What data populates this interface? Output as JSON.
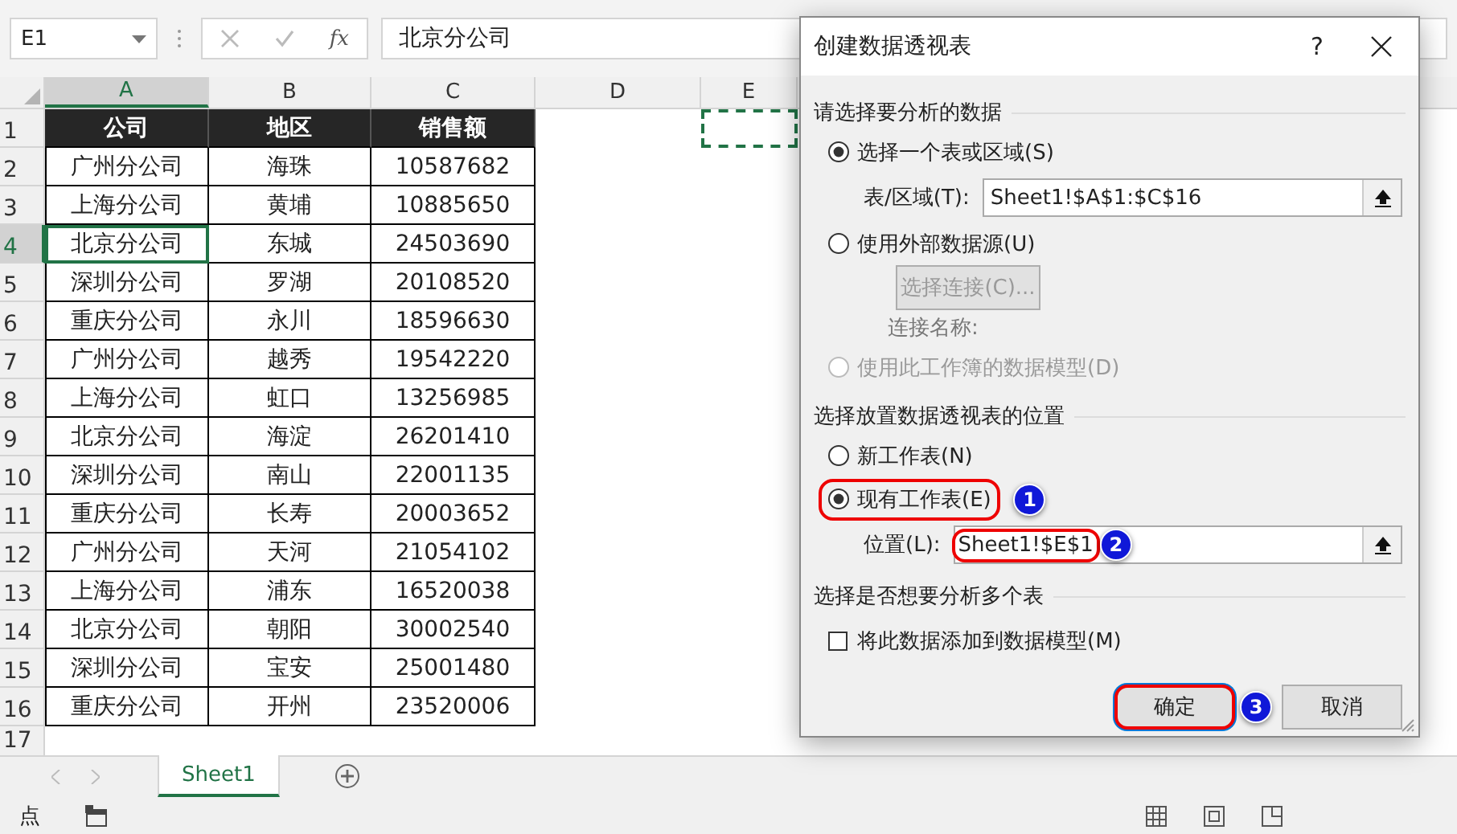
{
  "formula_bar": {
    "name_box": "E1",
    "function_label": "fx",
    "formula": "北京分公司"
  },
  "copy_marquee": true,
  "columns": [
    {
      "label": "A",
      "selected": true
    },
    {
      "label": "B",
      "selected": false
    },
    {
      "label": "C",
      "selected": false
    },
    {
      "label": "D",
      "selected": false
    },
    {
      "label": "E",
      "selected": false
    }
  ],
  "rows": [
    {
      "number": "1",
      "kind": "header",
      "selected": false,
      "cells": [
        "公司",
        "地区",
        "销售额"
      ]
    },
    {
      "number": "2",
      "kind": "data",
      "selected": false,
      "cells": [
        "广州分公司",
        "海珠",
        "10587682"
      ]
    },
    {
      "number": "3",
      "kind": "data",
      "selected": false,
      "cells": [
        "上海分公司",
        "黄埔",
        "10885650"
      ]
    },
    {
      "number": "4",
      "kind": "data",
      "selected": true,
      "cells": [
        "北京分公司",
        "东城",
        "24503690"
      ]
    },
    {
      "number": "5",
      "kind": "data",
      "selected": false,
      "cells": [
        "深圳分公司",
        "罗湖",
        "20108520"
      ]
    },
    {
      "number": "6",
      "kind": "data",
      "selected": false,
      "cells": [
        "重庆分公司",
        "永川",
        "18596630"
      ]
    },
    {
      "number": "7",
      "kind": "data",
      "selected": false,
      "cells": [
        "广州分公司",
        "越秀",
        "19542220"
      ]
    },
    {
      "number": "8",
      "kind": "data",
      "selected": false,
      "cells": [
        "上海分公司",
        "虹口",
        "13256985"
      ]
    },
    {
      "number": "9",
      "kind": "data",
      "selected": false,
      "cells": [
        "北京分公司",
        "海淀",
        "26201410"
      ]
    },
    {
      "number": "10",
      "kind": "data",
      "selected": false,
      "cells": [
        "深圳分公司",
        "南山",
        "22001135"
      ]
    },
    {
      "number": "11",
      "kind": "data",
      "selected": false,
      "cells": [
        "重庆分公司",
        "长寿",
        "20003652"
      ]
    },
    {
      "number": "12",
      "kind": "data",
      "selected": false,
      "cells": [
        "广州分公司",
        "天河",
        "21054102"
      ]
    },
    {
      "number": "13",
      "kind": "data",
      "selected": false,
      "cells": [
        "上海分公司",
        "浦东",
        "16520038"
      ]
    },
    {
      "number": "14",
      "kind": "data",
      "selected": false,
      "cells": [
        "北京分公司",
        "朝阳",
        "30002540"
      ]
    },
    {
      "number": "15",
      "kind": "data",
      "selected": false,
      "cells": [
        "深圳分公司",
        "宝安",
        "25001480"
      ]
    },
    {
      "number": "16",
      "kind": "data",
      "selected": false,
      "cells": [
        "重庆分公司",
        "开州",
        "23520006"
      ]
    },
    {
      "number": "17",
      "kind": "empty",
      "selected": false,
      "cells": []
    }
  ],
  "sheet_tabs": [
    {
      "label": "Sheet1",
      "selected": true
    }
  ],
  "status_bar": {
    "text": "点"
  },
  "dialog": {
    "title": "创建数据透视表",
    "help": "?",
    "sections": [
      {
        "heading": "请选择要分析的数据",
        "items": [
          {
            "kind": "radio",
            "label": "选择一个表或区域(S)",
            "selected": true,
            "disabled": false,
            "highlighted": false
          },
          {
            "kind": "field",
            "label": "表/区域(T):",
            "value": "Sheet1!$A$1:$C$16",
            "highlighted": false
          },
          {
            "kind": "radio",
            "label": "使用外部数据源(U)",
            "selected": false,
            "disabled": false,
            "highlighted": false
          },
          {
            "kind": "button",
            "label": "选择连接(C)...",
            "disabled": true
          },
          {
            "kind": "note",
            "label": "连接名称:"
          },
          {
            "kind": "radio",
            "label": "使用此工作簿的数据模型(D)",
            "selected": false,
            "disabled": true,
            "highlighted": false
          }
        ]
      },
      {
        "heading": "选择放置数据透视表的位置",
        "items": [
          {
            "kind": "radio",
            "label": "新工作表(N)",
            "selected": false,
            "disabled": false,
            "highlighted": false
          },
          {
            "kind": "radio",
            "label": "现有工作表(E)",
            "selected": true,
            "disabled": false,
            "highlighted": true,
            "annotation": "1"
          },
          {
            "kind": "field",
            "label": "位置(L):",
            "value": "Sheet1!$E$1",
            "highlighted": true,
            "annotation": "2"
          }
        ]
      },
      {
        "heading": "选择是否想要分析多个表",
        "items": [
          {
            "kind": "checkbox",
            "label": "将此数据添加到数据模型(M)",
            "checked": false
          }
        ]
      }
    ],
    "buttons": [
      {
        "label": "确定",
        "highlighted": true,
        "annotation": "3"
      },
      {
        "label": "取消",
        "highlighted": false
      }
    ]
  }
}
